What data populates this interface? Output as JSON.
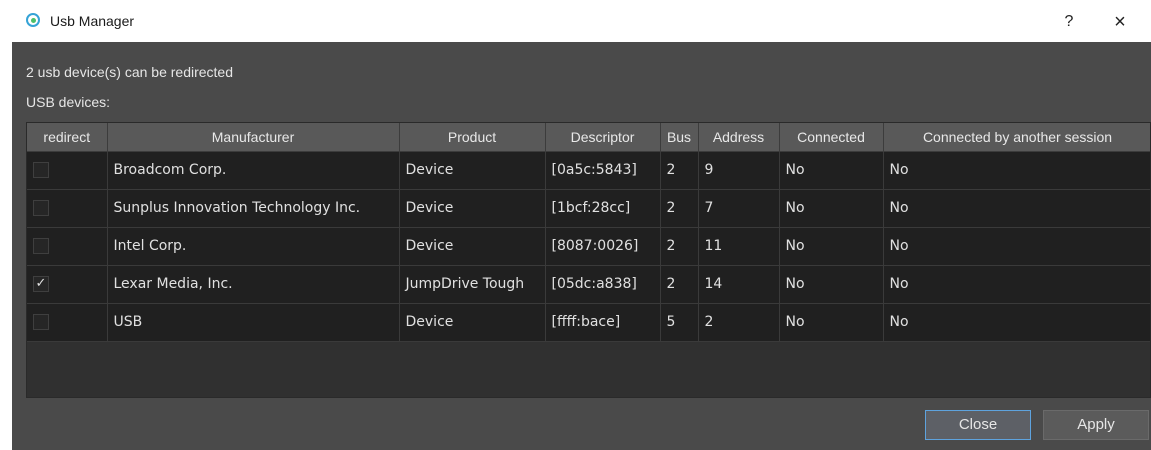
{
  "window": {
    "title": "Usb Manager",
    "help_label": "?",
    "close_label": "×"
  },
  "status_text": "2 usb device(s) can be redirected",
  "devices_label": "USB devices:",
  "table": {
    "headers": [
      "redirect",
      "Manufacturer",
      "Product",
      "Descriptor",
      "Bus",
      "Address",
      "Connected",
      "Connected by another session"
    ],
    "rows": [
      {
        "redirect": false,
        "manufacturer": "Broadcom Corp.",
        "product": "Device",
        "descriptor": "[0a5c:5843]",
        "bus": "2",
        "address": "9",
        "connected": "No",
        "other_session": "No"
      },
      {
        "redirect": false,
        "manufacturer": "Sunplus Innovation Technology Inc.",
        "product": "Device",
        "descriptor": "[1bcf:28cc]",
        "bus": "2",
        "address": "7",
        "connected": "No",
        "other_session": "No"
      },
      {
        "redirect": false,
        "manufacturer": "Intel Corp.",
        "product": "Device",
        "descriptor": "[8087:0026]",
        "bus": "2",
        "address": "11",
        "connected": "No",
        "other_session": "No"
      },
      {
        "redirect": true,
        "manufacturer": "Lexar Media, Inc.",
        "product": "JumpDrive Tough",
        "descriptor": "[05dc:a838]",
        "bus": "2",
        "address": "14",
        "connected": "No",
        "other_session": "No"
      },
      {
        "redirect": false,
        "manufacturer": "USB",
        "product": "Device",
        "descriptor": "[ffff:bace]",
        "bus": "5",
        "address": "2",
        "connected": "No",
        "other_session": "No"
      }
    ]
  },
  "buttons": {
    "close_label": "Close",
    "apply_label": "Apply"
  },
  "colors": {
    "accent": "#5ea3de",
    "app_icon": "#35a3d6"
  },
  "icons": {
    "app": "usb-manager-app-icon",
    "check": "checkmark-icon"
  }
}
